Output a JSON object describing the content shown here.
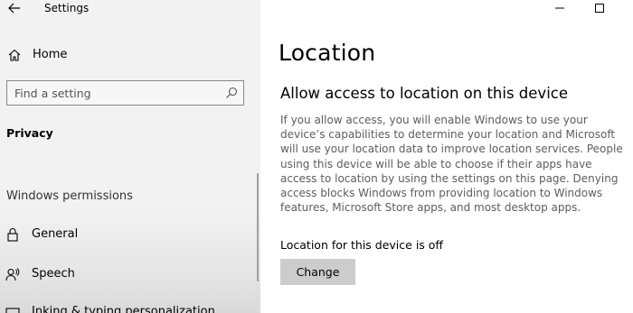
{
  "window": {
    "title": "Settings"
  },
  "sidebar": {
    "home_label": "Home",
    "search_placeholder": "Find a setting",
    "section_label": "Privacy",
    "group_label": "Windows permissions",
    "items": [
      {
        "label": "General",
        "icon": "lock-icon"
      },
      {
        "label": "Speech",
        "icon": "speech-icon"
      },
      {
        "label": "Inking & typing personalization",
        "icon": "inking-icon"
      }
    ]
  },
  "main": {
    "title": "Location",
    "subtitle": "Allow access to location on this device",
    "description": "If you allow access, you will enable Windows to use your device’s capabilities to determine your location and Microsoft will use your location data to improve location services. People using this device will be able to choose if their apps have access to location by using the settings on this page. Denying access blocks Windows from providing location to Windows features, Microsoft Store apps, and most desktop apps.",
    "status": "Location for this device is off",
    "change_label": "Change"
  },
  "colors": {
    "sidebar_bg": "#f2f2f2",
    "button_bg": "#cccccc",
    "desc_text": "#5d5d5d"
  }
}
